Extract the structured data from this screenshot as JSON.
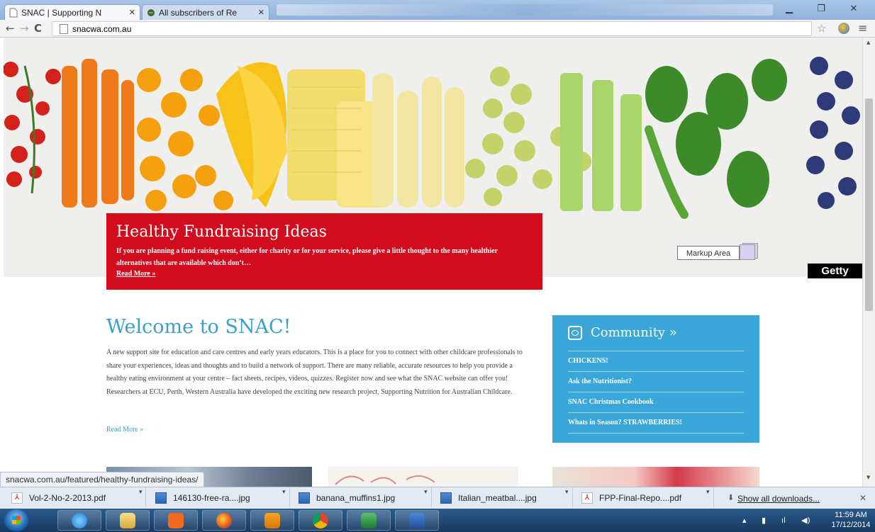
{
  "browser": {
    "tabs": [
      {
        "title": "SNAC | Supporting N",
        "active": true
      },
      {
        "title": "All subscribers of Re",
        "active": false
      }
    ],
    "url": "snacwa.com.au",
    "status_url": "snacwa.com.au/featured/healthy-fundraising-ideas/"
  },
  "hero": {
    "title": "Healthy Fundraising Ideas",
    "text": "If you are planning a fund raising event, either for charity or for your service, please give a little thought to the many healthier alternatives that are available which don’t…",
    "read_more": "Read More »",
    "markup_label": "Markup Area",
    "getty_label": "Getty"
  },
  "welcome": {
    "heading": "Welcome to SNAC!",
    "text": "A new support site for education and care centres and early years educators.  This is a place for you to connect with other childcare professionals to share your experiences, ideas and thoughts and to build a network of support.   There are many reliable, accurate resources to help you provide a healthy eating environment at your centre – fact sheets, recipes, videos, quizzes.  Register now and see what the SNAC website can offer you! Researchers at ECU, Perth, Western Australia have developed the exciting new research project, Supporting Nutrition for Australian Childcare.",
    "read_more": "Read More »"
  },
  "community": {
    "heading": "Community »",
    "items": [
      "CHICKENS!",
      "Ask the Nutritionist?",
      "SNAC Christmas Cookbook",
      "Whats in Season? STRAWBERRIES!"
    ]
  },
  "downloads": {
    "items": [
      {
        "name": "Vol-2-No-2-2013.pdf",
        "icon": "pdf-icon"
      },
      {
        "name": "146130-free-ra....jpg",
        "icon": "image-icon"
      },
      {
        "name": "banana_muffins1.jpg",
        "icon": "image-icon"
      },
      {
        "name": "Italian_meatbal....jpg",
        "icon": "image-icon"
      },
      {
        "name": "FPP-Final-Repo....pdf",
        "icon": "pdf-icon"
      }
    ],
    "show_all": "Show all downloads..."
  },
  "taskbar": {
    "apps": [
      "internet-explorer",
      "file-explorer",
      "media-player",
      "firefox",
      "outlook",
      "chrome",
      "excel",
      "word"
    ],
    "clock_time": "11:59 AM",
    "clock_date": "17/12/2014"
  },
  "colors": {
    "hero_red": "#d20c1e",
    "accent_blue": "#3aa0c9",
    "community_blue": "#3aa7d8"
  }
}
